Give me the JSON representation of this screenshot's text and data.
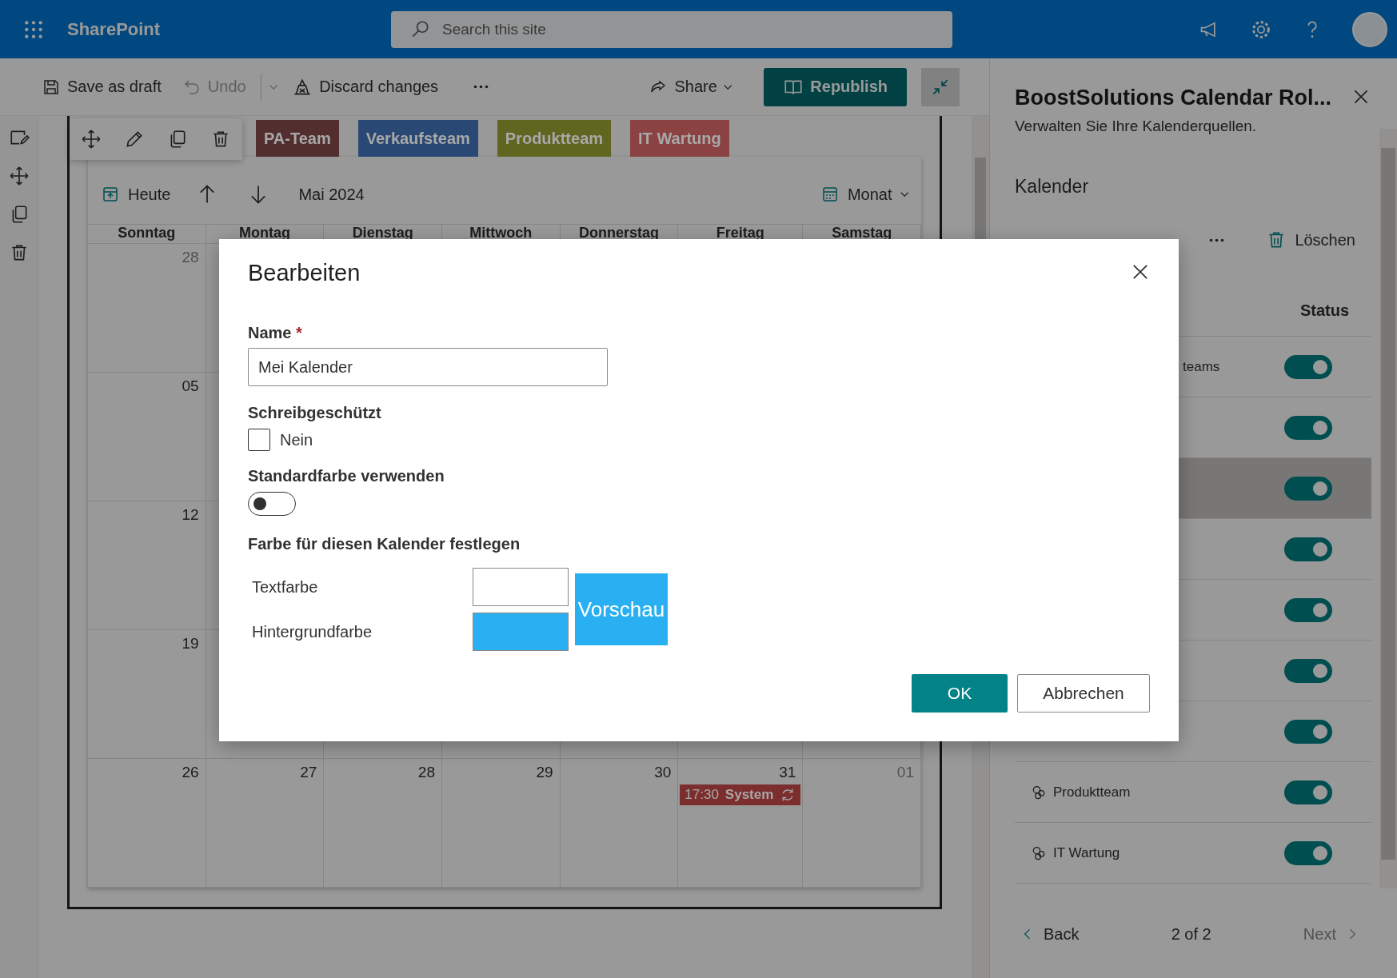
{
  "topbar": {
    "app_name": "SharePoint",
    "search": {
      "placeholder": "Search this site"
    }
  },
  "command_bar": {
    "save": "Save as draft",
    "undo": {
      "label": "Undo",
      "disabled": true
    },
    "discard": "Discard changes",
    "share": "Share",
    "republish": "Republish"
  },
  "calendar": {
    "categories": [
      {
        "label": "PA-Team",
        "color": "#532e2e"
      },
      {
        "label": "Verkaufsteam",
        "color": "#2a4874"
      },
      {
        "label": "Produktteam",
        "color": "#606620"
      },
      {
        "label": "IT Wartung",
        "color": "#8a4242"
      }
    ],
    "today": "Heute",
    "month_label": "Mai 2024",
    "view": "Monat",
    "weekdays": [
      "Sonntag",
      "Montag",
      "Dienstag",
      "Mittwoch",
      "Donnerstag",
      "Freitag",
      "Samstag"
    ],
    "weeks": [
      {
        "days": [
          {
            "date": "28",
            "other_month": true
          }
        ]
      },
      {
        "days": [
          {
            "date": "05",
            "other_month": false
          }
        ]
      },
      {
        "days": [
          {
            "date": "12",
            "other_month": false
          }
        ]
      },
      {
        "days": [
          {
            "date": "19",
            "other_month": false
          }
        ]
      },
      {
        "days": [
          {
            "date": "26",
            "other_month": false
          },
          {
            "date": "27",
            "other_month": false
          },
          {
            "date": "28",
            "other_month": false
          },
          {
            "date": "29",
            "other_month": false
          },
          {
            "date": "30",
            "other_month": false
          },
          {
            "date": "31",
            "other_month": false,
            "events": [
              {
                "time": "17:30",
                "title": "System",
                "recurring": true,
                "color": "#7c2e2e"
              }
            ]
          },
          {
            "date": "01",
            "other_month": true
          }
        ]
      }
    ]
  },
  "panel": {
    "title": "BoostSolutions Calendar Rol...",
    "description": "Verwalten Sie Ihre Kalenderquellen.",
    "section": "Kalender",
    "delete": "Löschen",
    "status_header": "Status",
    "calendars": [
      {
        "kind": "partial",
        "name": "teams",
        "on": true,
        "selected": false
      },
      {
        "kind": "hidden",
        "on": true,
        "selected": false
      },
      {
        "kind": "hidden",
        "on": true,
        "selected": true
      },
      {
        "kind": "hidden",
        "on": true,
        "selected": false
      },
      {
        "kind": "hidden",
        "on": true,
        "selected": false
      },
      {
        "kind": "hidden",
        "on": true,
        "selected": false
      },
      {
        "kind": "hidden",
        "on": true,
        "selected": false
      },
      {
        "kind": "site",
        "name": "Produktteam",
        "on": true,
        "selected": false
      },
      {
        "kind": "site",
        "name": "IT Wartung",
        "on": true,
        "selected": false
      }
    ],
    "pager": {
      "back": "Back",
      "page": "2 of 2",
      "next": "Next",
      "next_disabled": true
    }
  },
  "dialog": {
    "title": "Bearbeiten",
    "name_label": "Name",
    "required_mark": "*",
    "name_value": "Mei Kalender",
    "read_only": {
      "label": "Schreibgeschützt",
      "option": "Nein",
      "checked": false
    },
    "default_color": {
      "label": "Standardfarbe verwenden",
      "on": false
    },
    "color_heading": "Farbe für diesen Kalender festlegen",
    "text_color": {
      "label": "Textfarbe",
      "color": "#ffffff"
    },
    "background_color": {
      "label": "Hintergrundfarbe",
      "color": "#2ab0f2"
    },
    "preview": "Vorschau",
    "ok": "OK",
    "cancel": "Abbrechen"
  }
}
